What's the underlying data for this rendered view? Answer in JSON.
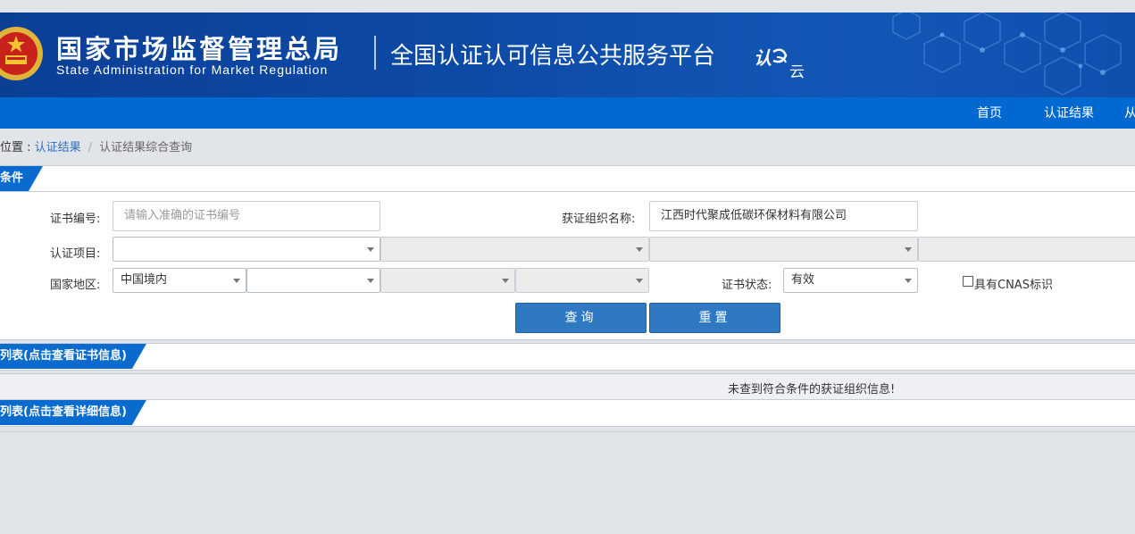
{
  "header": {
    "org_name_cn": "国家市场监督管理总局",
    "org_name_en": "State Administration  for  Market Regulation",
    "platform_title": "全国认证认可信息公共服务平台",
    "cloud_logo_text": "认云",
    "brand_color": "#0d4aa6"
  },
  "nav": {
    "items": [
      {
        "label": "首页"
      },
      {
        "label": "认证结果"
      },
      {
        "label": "从"
      }
    ],
    "background": "#0069d1"
  },
  "breadcrumb": {
    "prefix": "位置 : ",
    "link": "认证结果",
    "separator": "/",
    "current": "认证结果综合查询"
  },
  "search_panel": {
    "title": "条件",
    "cert_no": {
      "label": "证书编号:",
      "value": "",
      "placeholder": "请输入准确的证书编号"
    },
    "org_name": {
      "label": "获证组织名称:",
      "value": "江西时代聚成低碳环保材料有限公司"
    },
    "project": {
      "label": "认证项目:",
      "values": [
        "",
        "",
        "",
        ""
      ]
    },
    "region": {
      "label": "国家地区:",
      "values": [
        "中国境内",
        "",
        "",
        ""
      ]
    },
    "status": {
      "label": "证书状态:",
      "value": "有效"
    },
    "cnas": {
      "label": "具有CNAS标识",
      "checked": false
    },
    "query_button": "查询",
    "reset_button": "重置"
  },
  "cert_list": {
    "title": "列表(点击查看证书信息)",
    "empty_message": "未查到符合条件的获证组织信息!"
  },
  "detail_list": {
    "title": "列表(点击查看详细信息)"
  },
  "accent_color": "#0a6bcf",
  "button_color": "#2f79c2"
}
